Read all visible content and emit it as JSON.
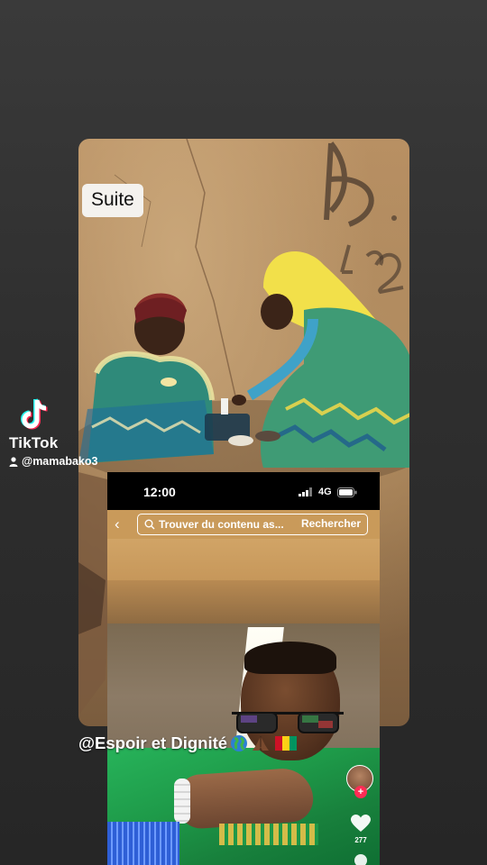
{
  "overlay": {
    "badge_text": "Suite",
    "caption_text": "@Espoir et Dignité",
    "caption_emojis": [
      "globe-icon",
      "praying-hands-icon",
      "guinea-flag-icon"
    ]
  },
  "tiktok": {
    "brand": "TikTok",
    "handle": "@mamabako3"
  },
  "phone": {
    "status_time": "12:00",
    "network": "4G",
    "search_placeholder": "Trouver du contenu as...",
    "search_button": "Rechercher",
    "like_count": "277"
  },
  "colors": {
    "tiktok_cyan": "#25f4ee",
    "tiktok_red": "#fe2c55",
    "flag_red": "#ce1126",
    "flag_yellow": "#fcd116",
    "flag_green": "#009460"
  }
}
